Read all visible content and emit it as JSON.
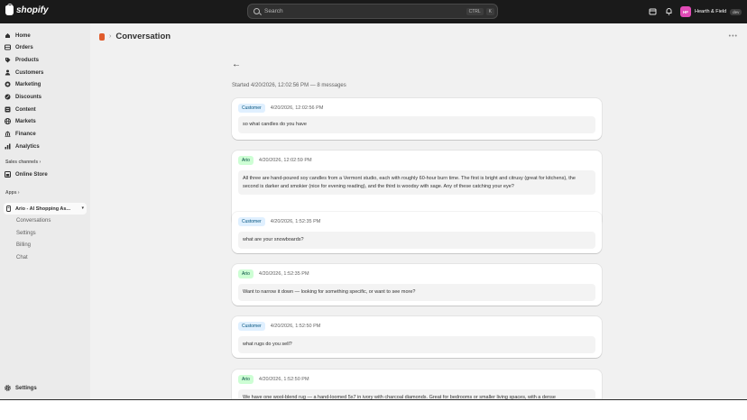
{
  "topbar": {
    "logo_text": "shopify",
    "search_placeholder": "Search",
    "shortcut_ctrl": "CTRL",
    "shortcut_key": "K",
    "store_initials": "HF",
    "store_name": "Hearth & Field",
    "store_badge": "dev"
  },
  "sidebar": {
    "items": [
      {
        "label": "Home"
      },
      {
        "label": "Orders"
      },
      {
        "label": "Products"
      },
      {
        "label": "Customers"
      },
      {
        "label": "Marketing"
      },
      {
        "label": "Discounts"
      },
      {
        "label": "Content"
      },
      {
        "label": "Markets"
      },
      {
        "label": "Finance"
      },
      {
        "label": "Analytics"
      }
    ],
    "sales_channels_label": "Sales channels",
    "online_store_label": "Online Store",
    "apps_label": "Apps",
    "app_name": "Ario - AI Shopping As...",
    "app_subitems": [
      "Conversations",
      "Settings",
      "Billing",
      "Chat"
    ],
    "settings_label": "Settings"
  },
  "main": {
    "title": "Conversation",
    "meta": "Started 4/20/2026, 12:02:56 PM — 8 messages",
    "messages": [
      {
        "role": "Customer",
        "time": "4/20/2026, 12:02:56 PM",
        "text": "so what candles do you have"
      },
      {
        "role": "Ario",
        "time": "4/20/2026, 12:02:59 PM",
        "text": "All three are hand-poured soy candles from a Vermont studio, each with roughly 60-hour burn time. The first is bright and citrusy (great for kitchens), the second is darker and smokier (nice for evening reading), and the third is woodsy with sage. Any of these catching your eye?"
      },
      {
        "role": "Customer",
        "time": "4/20/2026, 1:52:35 PM",
        "text": "what are your snowboards?"
      },
      {
        "role": "Ario",
        "time": "4/20/2026, 1:52:35 PM",
        "text": "Want to narrow it down — looking for something specific, or want to see more?"
      },
      {
        "role": "Customer",
        "time": "4/20/2026, 1:52:50 PM",
        "text": "what rugs do you sell?"
      },
      {
        "role": "Ario",
        "time": "4/20/2026, 1:52:50 PM",
        "text": "We have one wool-blend rug — a hand-loomed 5x7 in ivory with charcoal diamonds. Great for bedrooms or smaller living spaces, with a dense"
      }
    ]
  },
  "colors": {
    "topbar": "#1a1a1a",
    "sidebar": "#ebebeb",
    "main_bg": "#f1f1f1",
    "customer_badge": "#e0f0ff",
    "ario_badge": "#cdfed4"
  }
}
